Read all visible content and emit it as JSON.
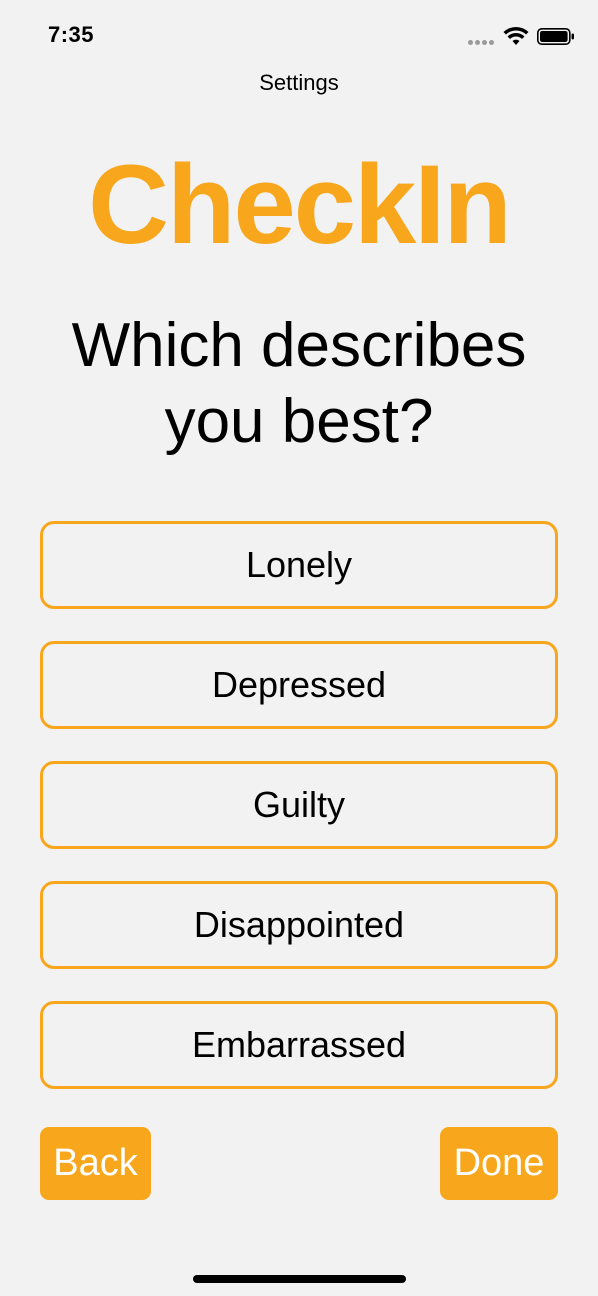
{
  "status_bar": {
    "time": "7:35",
    "icons": [
      "signal-dots-icon",
      "wifi-icon",
      "battery-icon"
    ]
  },
  "header": {
    "settings_label": "Settings"
  },
  "brand": {
    "title": "CheckIn",
    "accent_color": "#f8a61c"
  },
  "question": {
    "text": "Which describes you best?"
  },
  "options": [
    {
      "label": "Lonely"
    },
    {
      "label": "Depressed"
    },
    {
      "label": "Guilty"
    },
    {
      "label": "Disappointed"
    },
    {
      "label": "Embarrassed"
    }
  ],
  "navigation": {
    "back_label": "Back",
    "done_label": "Done"
  }
}
